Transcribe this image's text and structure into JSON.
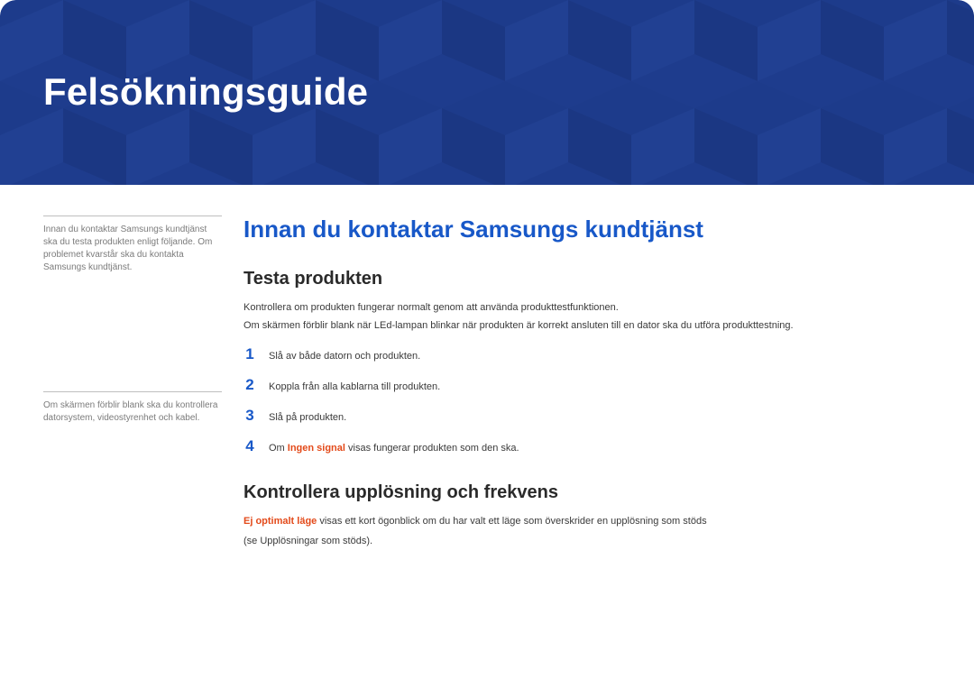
{
  "banner": {
    "title": "Felsökningsguide"
  },
  "sidebar": {
    "note1": "Innan du kontaktar Samsungs kundtjänst ska du testa produkten enligt följande. Om problemet kvarstår ska du kontakta Samsungs kundtjänst.",
    "note2": "Om skärmen förblir blank ska du kontrollera datorsystem, videostyrenhet och kabel."
  },
  "main": {
    "h1": "Innan du kontaktar Samsungs kundtjänst",
    "section1": {
      "h2": "Testa produkten",
      "p1": "Kontrollera om produkten fungerar normalt genom att använda produkttestfunktionen.",
      "p2": "Om skärmen förblir blank när LEd-lampan blinkar när produkten är korrekt ansluten till en dator ska du utföra produkttestning.",
      "steps": [
        {
          "n": "1",
          "text": "Slå av både datorn och produkten."
        },
        {
          "n": "2",
          "text": "Koppla från alla kablarna till produkten."
        },
        {
          "n": "3",
          "text": "Slå på produkten."
        },
        {
          "n": "4",
          "prefix": "Om ",
          "hl": "Ingen signal",
          "suffix": " visas fungerar produkten som den ska."
        }
      ]
    },
    "section2": {
      "h2": "Kontrollera upplösning och frekvens",
      "p_hl": "Ej optimalt läge",
      "p_suffix": " visas ett kort ögonblick om du har valt ett läge som överskrider en upplösning som stöds",
      "p2": "(se Upplösningar som stöds)."
    }
  }
}
